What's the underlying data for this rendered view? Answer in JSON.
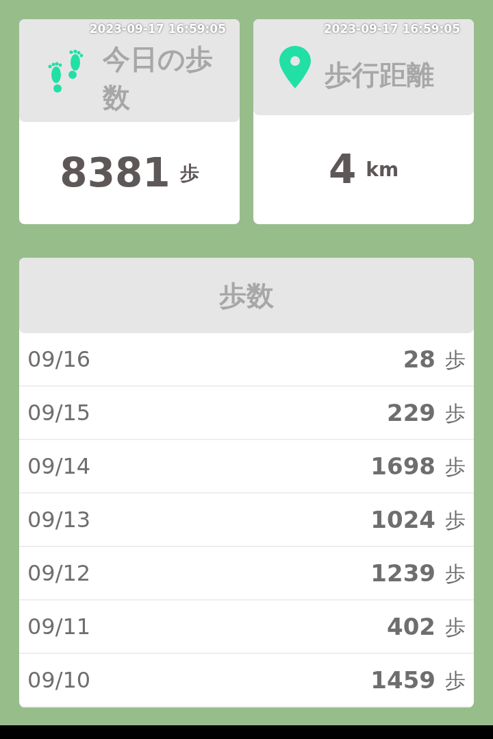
{
  "summary_cards": [
    {
      "kind": "steps",
      "timestamp": "2023-09-17 16:59:05",
      "title": "今日の歩数",
      "value": "8381",
      "unit": "歩"
    },
    {
      "kind": "distance",
      "timestamp": "2023-09-17 16:59:05",
      "title": "歩行距離",
      "value": "4",
      "unit": "km"
    }
  ],
  "history": {
    "title": "歩数",
    "rows": [
      {
        "date": "09/16",
        "count": "28",
        "unit": "歩"
      },
      {
        "date": "09/15",
        "count": "229",
        "unit": "歩"
      },
      {
        "date": "09/14",
        "count": "1698",
        "unit": "歩"
      },
      {
        "date": "09/13",
        "count": "1024",
        "unit": "歩"
      },
      {
        "date": "09/12",
        "count": "1239",
        "unit": "歩"
      },
      {
        "date": "09/11",
        "count": "402",
        "unit": "歩"
      },
      {
        "date": "09/10",
        "count": "1459",
        "unit": "歩"
      }
    ]
  }
}
